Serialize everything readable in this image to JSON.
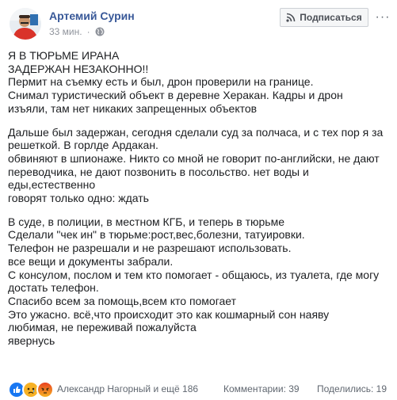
{
  "post": {
    "author": "Артемий Сурин",
    "time": "33 мин.",
    "separator": "·",
    "privacy_icon": "globe-icon",
    "subscribe_label": "Подписаться",
    "subscribe_icon": "rss-icon",
    "more_label": "···",
    "paragraphs": [
      [
        "Я В ТЮРЬМЕ ИРАНА",
        "ЗАДЕРЖАН НЕЗАКОННО!!",
        "Пермит на съемку есть и был, дрон проверили на границе.",
        "Снимал туристический объект в деревне Хеpакан. Кадры и дрон",
        "изъяли, там нет никаких запрещенных объектов"
      ],
      [
        "Дальше был задержан, сегодня сделали суд за полчаса, и с тех пор я за",
        "решеткой. В горлде Ардакан.",
        "обвиняют в шпионаже. Никто со мной не говорит по-английски, не дают",
        "переводчика, не дают позвонить в посольство. нет воды и",
        "еды,естественно",
        "говорят только одно: ждать"
      ],
      [
        "В суде, в полиции, в местном КГБ, и теперь в тюрьме",
        "Сделали \"чек ин\" в тюрьме:рост,вес,болезни, татуировки.",
        "Телефон не разрешали и не разрешают использовать.",
        "все вещи и документы забрали.",
        "С консулом, послом и тем кто помогает - общаюсь, из туалета, где могу",
        "достать телефон.",
        "Спасибо всем за помощь,всем кто помогает",
        "Это ужасно. всё,что происходит это как кошмарный сон наяву",
        "любимая, не переживай пожалуйста",
        "явернусь"
      ]
    ]
  },
  "footer": {
    "reactions": [
      {
        "name": "like-reaction-icon",
        "color": "#1877f2"
      },
      {
        "name": "sad-reaction-icon",
        "color": "#f7b125"
      },
      {
        "name": "angry-reaction-icon",
        "color": "#e9710f"
      }
    ],
    "reactors_text": "Александр Нагорный и ещё 186",
    "comments_text": "Комментарии: 39",
    "shares_text": "Поделились: 19"
  }
}
